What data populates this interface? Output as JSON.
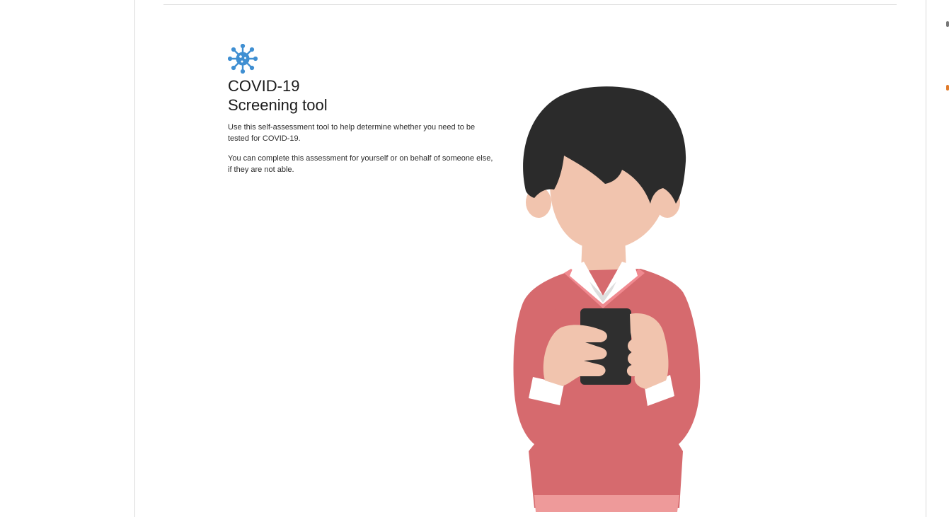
{
  "tool": {
    "icon": "virus-icon",
    "title_line1": "COVID-19",
    "title_line2": "Screening tool",
    "description1": "Use this self-assessment tool to help determine whether you need to be tested for COVID-19.",
    "description2": "You can complete this assessment for yourself or on behalf of someone else, if they are not able."
  },
  "illustration": {
    "subject": "person-holding-phone-illustration"
  },
  "colors": {
    "accent": "#3f8fd2",
    "sweater": "#d66a6e",
    "hair": "#2b2b2b",
    "skin": "#f1c4ae"
  }
}
